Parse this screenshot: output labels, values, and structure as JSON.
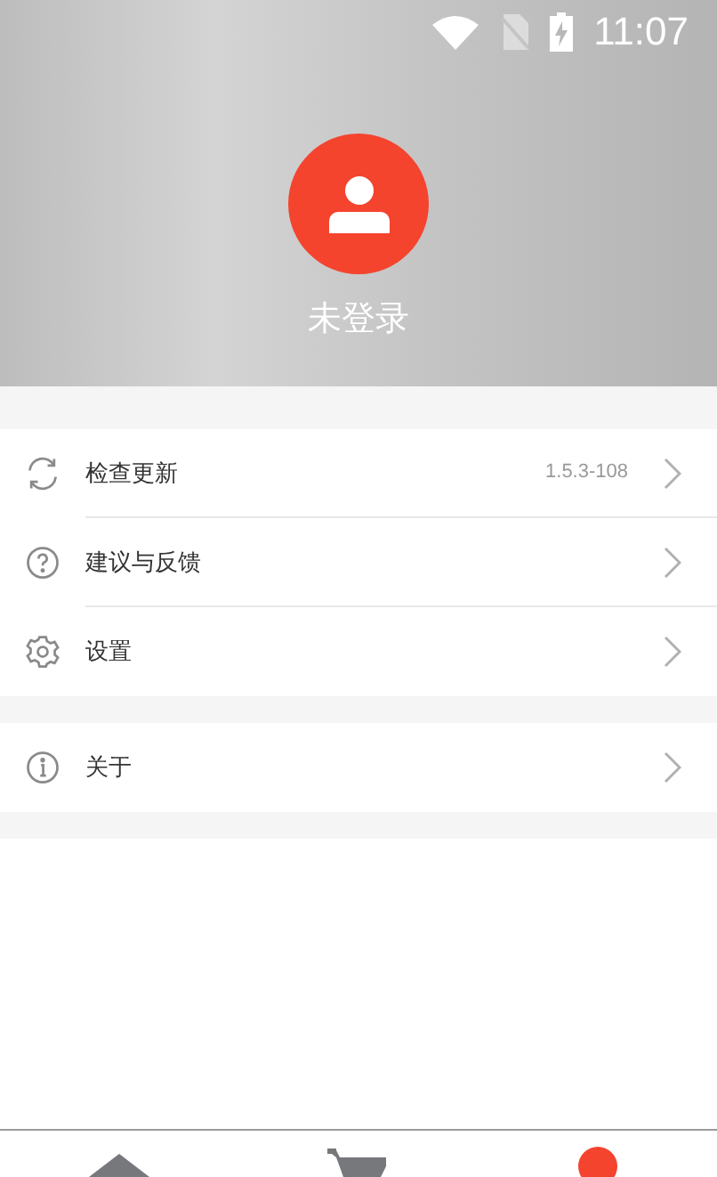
{
  "status_bar": {
    "time": "11:07"
  },
  "profile": {
    "name": "未登录"
  },
  "menu_groups": [
    {
      "items": [
        {
          "kind": "refresh",
          "label": "检查更新",
          "value": "1.5.3-108"
        },
        {
          "kind": "help",
          "label": "建议与反馈"
        },
        {
          "kind": "settings",
          "label": "设置"
        }
      ]
    },
    {
      "items": [
        {
          "kind": "info",
          "label": "关于"
        }
      ]
    }
  ],
  "tab_bar": [
    {
      "kind": "home",
      "selected": false
    },
    {
      "kind": "cart",
      "selected": false
    },
    {
      "kind": "profile",
      "selected": true
    }
  ]
}
